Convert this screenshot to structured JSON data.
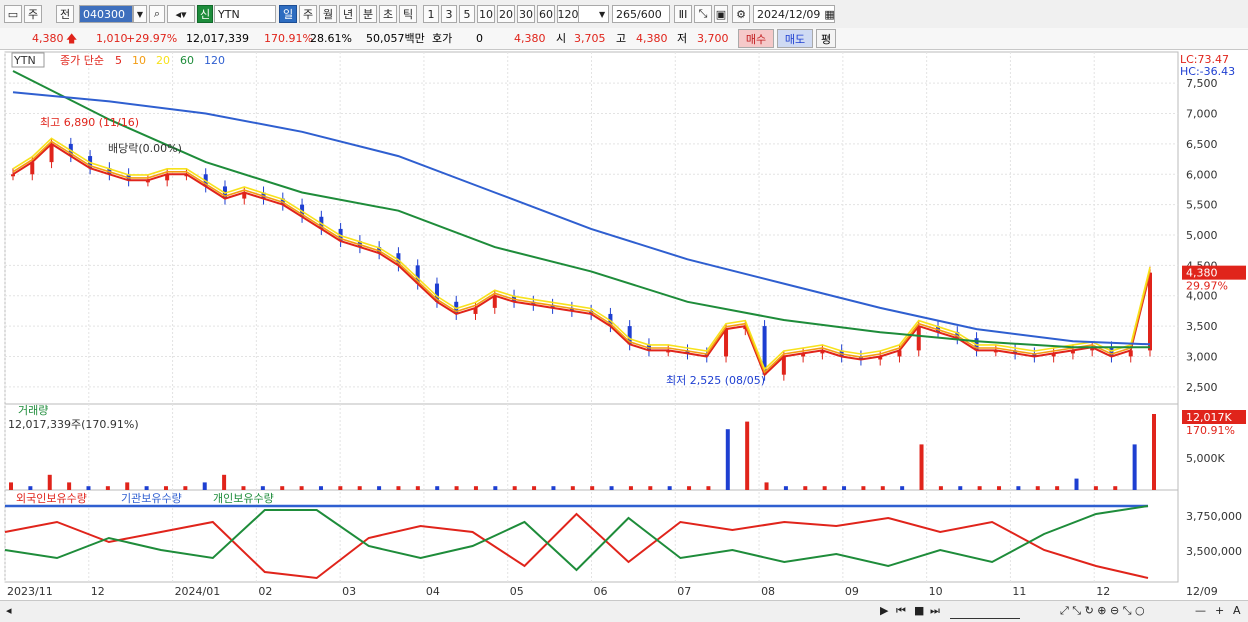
{
  "toolbar": {
    "period_main": "주",
    "prev_label": "전",
    "code": "040300",
    "new_badge": "신",
    "stock_name": "YTN",
    "periods": [
      "일",
      "주",
      "월",
      "년",
      "분",
      "초",
      "틱"
    ],
    "active_period": "일",
    "numbers": [
      "1",
      "3",
      "5",
      "10",
      "20",
      "30",
      "60",
      "120"
    ],
    "count": "265",
    "count_total": "/600",
    "date": "2024/12/09"
  },
  "quote": {
    "price": "4,380",
    "change": "1,010",
    "change_pct": "+29.97%",
    "volume": "12,017,339",
    "volume_pct": "170.91%",
    "turnover": "28.61%",
    "amount": "50,057백만",
    "hoga_label": "호가",
    "hoga_value": "0",
    "ask_price": "4,380",
    "open_label": "시",
    "open": "3,705",
    "high_label": "고",
    "high": "4,380",
    "low_label": "저",
    "low": "3,700",
    "buy_label": "매수",
    "sell_label": "매도",
    "eval_label": "평"
  },
  "price_panel": {
    "symbol": "YTN",
    "ma_label": "종가 단순",
    "ma_periods": [
      {
        "p": "5",
        "color": "#e0241b"
      },
      {
        "p": "10",
        "color": "#f39c12"
      },
      {
        "p": "20",
        "color": "#f7e21c"
      },
      {
        "p": "60",
        "color": "#1e8c3a"
      },
      {
        "p": "120",
        "color": "#2f5fd0"
      }
    ],
    "lc": "LC:73.47",
    "hc": "HC:-36.43",
    "axis_ticks": [
      "7,500",
      "7,000",
      "6,500",
      "6,000",
      "5,500",
      "5,000",
      "4,500",
      "4,000",
      "3,500",
      "3,000",
      "2,500"
    ],
    "axis_values": [
      7500,
      7000,
      6500,
      6000,
      5500,
      5000,
      4500,
      4000,
      3500,
      3000,
      2500
    ],
    "last_price_badge": "4,380",
    "last_pct_badge": "29.97%",
    "high_annotation": "최고 6,890 (11/16)",
    "low_annotation": "최저 2,525 (08/05)",
    "dividend_annotation": "배당락(0.00%)"
  },
  "volume_panel": {
    "title": "거래량",
    "value": "12,017,339주(170.91%)",
    "axis_tick": "5,000K",
    "badge_value": "12,017K",
    "badge_pct": "170.91%"
  },
  "holdings_panel": {
    "legend": [
      {
        "label": "외국인보유수량",
        "color": "#e0241b"
      },
      {
        "label": "기관보유수량",
        "color": "#2f5fd0"
      },
      {
        "label": "개인보유수량",
        "color": "#1e8c3a"
      }
    ],
    "axis_ticks": [
      "3,750,000",
      "3,500,000"
    ]
  },
  "x_axis": {
    "labels": [
      "2023/11",
      "12",
      "2024/01",
      "02",
      "03",
      "04",
      "05",
      "06",
      "07",
      "08",
      "09",
      "10",
      "11",
      "12"
    ],
    "end_date": "12/09"
  },
  "colors": {
    "up": "#e0241b",
    "down": "#1e3fd1",
    "ma5": "#e0241b",
    "ma10": "#f39c12",
    "ma20": "#f7e21c",
    "ma60": "#1e8c3a",
    "ma120": "#2f5fd0"
  },
  "chart_data": {
    "type": "line",
    "price_points": [
      [
        0,
        6000
      ],
      [
        1,
        6200
      ],
      [
        2,
        6500
      ],
      [
        3,
        6300
      ],
      [
        4,
        6100
      ],
      [
        5,
        6000
      ],
      [
        6,
        5900
      ],
      [
        7,
        5900
      ],
      [
        8,
        6000
      ],
      [
        9,
        6000
      ],
      [
        10,
        5800
      ],
      [
        11,
        5600
      ],
      [
        12,
        5700
      ],
      [
        13,
        5600
      ],
      [
        14,
        5500
      ],
      [
        15,
        5300
      ],
      [
        16,
        5100
      ],
      [
        17,
        4900
      ],
      [
        18,
        4800
      ],
      [
        19,
        4700
      ],
      [
        20,
        4500
      ],
      [
        21,
        4200
      ],
      [
        22,
        3900
      ],
      [
        23,
        3700
      ],
      [
        24,
        3800
      ],
      [
        25,
        4000
      ],
      [
        26,
        3900
      ],
      [
        27,
        3850
      ],
      [
        28,
        3800
      ],
      [
        29,
        3750
      ],
      [
        30,
        3700
      ],
      [
        31,
        3500
      ],
      [
        32,
        3200
      ],
      [
        33,
        3100
      ],
      [
        34,
        3100
      ],
      [
        35,
        3050
      ],
      [
        36,
        3000
      ],
      [
        37,
        3450
      ],
      [
        38,
        3500
      ],
      [
        39,
        2700
      ],
      [
        40,
        3000
      ],
      [
        41,
        3050
      ],
      [
        42,
        3100
      ],
      [
        43,
        3000
      ],
      [
        44,
        2950
      ],
      [
        45,
        3000
      ],
      [
        46,
        3100
      ],
      [
        47,
        3500
      ],
      [
        48,
        3400
      ],
      [
        49,
        3300
      ],
      [
        50,
        3100
      ],
      [
        51,
        3100
      ],
      [
        52,
        3050
      ],
      [
        53,
        3000
      ],
      [
        54,
        3050
      ],
      [
        55,
        3100
      ],
      [
        56,
        3150
      ],
      [
        57,
        3000
      ],
      [
        58,
        3100
      ],
      [
        59,
        4380
      ]
    ],
    "ma60": [
      [
        0,
        7700
      ],
      [
        5,
        6900
      ],
      [
        10,
        6200
      ],
      [
        15,
        5700
      ],
      [
        20,
        5400
      ],
      [
        25,
        4800
      ],
      [
        30,
        4400
      ],
      [
        35,
        3900
      ],
      [
        40,
        3600
      ],
      [
        45,
        3400
      ],
      [
        50,
        3250
      ],
      [
        55,
        3150
      ],
      [
        59,
        3150
      ]
    ],
    "ma120": [
      [
        0,
        7350
      ],
      [
        5,
        7200
      ],
      [
        10,
        7000
      ],
      [
        15,
        6700
      ],
      [
        20,
        6300
      ],
      [
        25,
        5700
      ],
      [
        30,
        5100
      ],
      [
        35,
        4600
      ],
      [
        40,
        4200
      ],
      [
        45,
        3800
      ],
      [
        50,
        3450
      ],
      [
        55,
        3250
      ],
      [
        59,
        3200
      ]
    ],
    "volume": [
      2,
      1,
      4,
      2,
      1,
      1,
      2,
      1,
      1,
      1,
      2,
      4,
      1,
      1,
      1,
      1,
      1,
      1,
      1,
      1,
      1,
      1,
      1,
      1,
      1,
      1,
      1,
      1,
      1,
      1,
      1,
      1,
      1,
      1,
      1,
      1,
      1,
      16,
      18,
      2,
      1,
      1,
      1,
      1,
      1,
      1,
      1,
      12,
      1,
      1,
      1,
      1,
      1,
      1,
      1,
      3,
      1,
      1,
      12,
      20
    ],
    "foreign": [
      [
        0,
        3650
      ],
      [
        5,
        3700
      ],
      [
        10,
        3600
      ],
      [
        15,
        3650
      ],
      [
        20,
        3700
      ],
      [
        25,
        3450
      ],
      [
        30,
        3420
      ],
      [
        35,
        3620
      ],
      [
        40,
        3680
      ],
      [
        45,
        3650
      ],
      [
        50,
        3480
      ],
      [
        55,
        3740
      ],
      [
        60,
        3500
      ],
      [
        65,
        3700
      ],
      [
        70,
        3660
      ],
      [
        75,
        3700
      ],
      [
        80,
        3680
      ],
      [
        85,
        3720
      ],
      [
        90,
        3650
      ],
      [
        95,
        3700
      ],
      [
        100,
        3560
      ],
      [
        105,
        3480
      ],
      [
        110,
        3420
      ]
    ],
    "institution": [
      [
        0,
        3780
      ],
      [
        110,
        3780
      ]
    ],
    "individual": [
      [
        0,
        3560
      ],
      [
        5,
        3520
      ],
      [
        10,
        3620
      ],
      [
        15,
        3560
      ],
      [
        20,
        3520
      ],
      [
        25,
        3760
      ],
      [
        30,
        3760
      ],
      [
        35,
        3580
      ],
      [
        40,
        3520
      ],
      [
        45,
        3580
      ],
      [
        50,
        3700
      ],
      [
        55,
        3460
      ],
      [
        60,
        3720
      ],
      [
        65,
        3520
      ],
      [
        70,
        3560
      ],
      [
        75,
        3500
      ],
      [
        80,
        3540
      ],
      [
        85,
        3480
      ],
      [
        90,
        3560
      ],
      [
        95,
        3500
      ],
      [
        100,
        3640
      ],
      [
        105,
        3740
      ],
      [
        110,
        3780
      ]
    ]
  }
}
